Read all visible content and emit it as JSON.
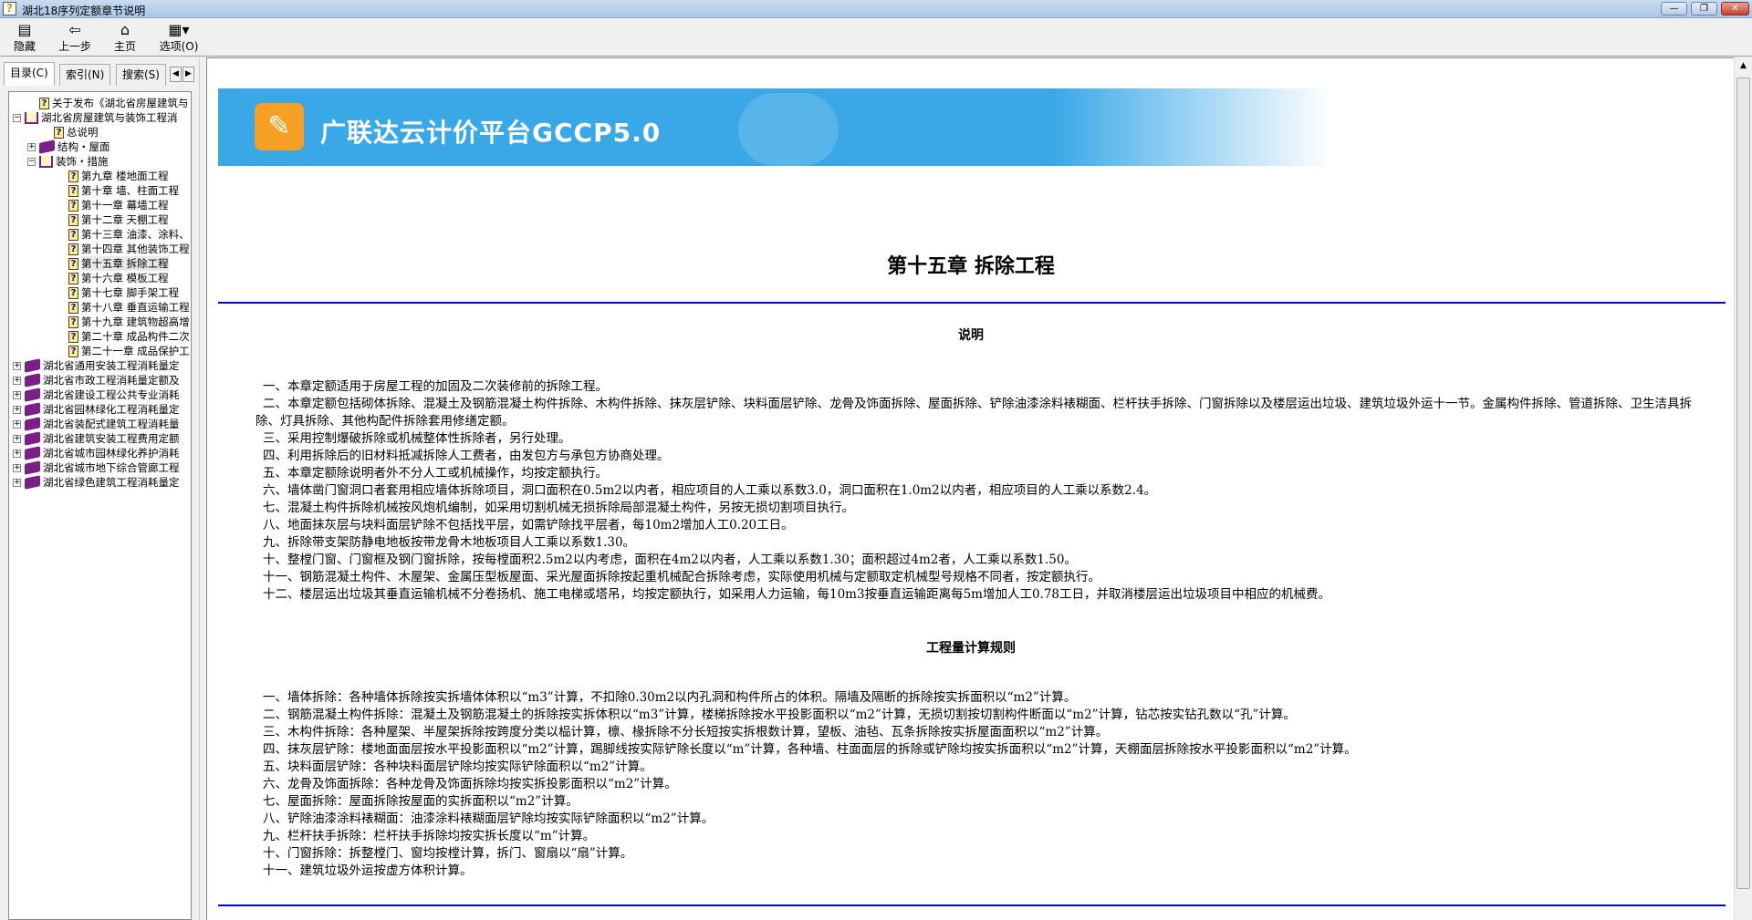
{
  "window": {
    "title": "湖北18序列定额章节说明",
    "min": "—",
    "restore": "❐",
    "close": "✕"
  },
  "toolbar": [
    {
      "label": "隐藏",
      "icon": "hide-icon"
    },
    {
      "label": "上一步",
      "icon": "back-icon"
    },
    {
      "label": "主页",
      "icon": "home-icon"
    },
    {
      "label": "选项(O)",
      "icon": "options-icon"
    }
  ],
  "tabs": [
    {
      "label": "目录(C)"
    },
    {
      "label": "索引(N)"
    },
    {
      "label": "搜索(S)"
    }
  ],
  "tree": [
    {
      "label": "关于发布《湖北省房屋建筑与",
      "type": "page",
      "level": 1
    },
    {
      "label": "湖北省房屋建筑与装饰工程消",
      "type": "open",
      "level": 0,
      "exp": "−"
    },
    {
      "label": "总说明",
      "type": "page",
      "level": 2
    },
    {
      "label": "结构・屋面",
      "type": "book",
      "level": 1,
      "exp": "+"
    },
    {
      "label": "装饰・措施",
      "type": "open",
      "level": 1,
      "exp": "−"
    },
    {
      "label": "第九章  楼地面工程",
      "type": "page",
      "level": 3
    },
    {
      "label": "第十章  墙、柱面工程",
      "type": "page",
      "level": 3
    },
    {
      "label": "第十一章  幕墙工程",
      "type": "page",
      "level": 3
    },
    {
      "label": "第十二章  天棚工程",
      "type": "page",
      "level": 3
    },
    {
      "label": "第十三章  油漆、涂料、",
      "type": "page",
      "level": 3
    },
    {
      "label": "第十四章  其他装饰工程",
      "type": "page",
      "level": 3
    },
    {
      "label": "第十五章  拆除工程",
      "type": "page",
      "level": 3,
      "selected": true
    },
    {
      "label": "第十六章  模板工程",
      "type": "page",
      "level": 3
    },
    {
      "label": "第十七章  脚手架工程",
      "type": "page",
      "level": 3
    },
    {
      "label": "第十八章  垂直运输工程",
      "type": "page",
      "level": 3
    },
    {
      "label": "第十九章  建筑物超高增",
      "type": "page",
      "level": 3
    },
    {
      "label": "第二十章  成品构件二次",
      "type": "page",
      "level": 3
    },
    {
      "label": "第二十一章  成品保护工",
      "type": "page",
      "level": 3
    },
    {
      "label": "湖北省通用安装工程消耗量定",
      "type": "book",
      "level": 0,
      "exp": "+"
    },
    {
      "label": "湖北省市政工程消耗量定额及",
      "type": "book",
      "level": 0,
      "exp": "+"
    },
    {
      "label": "湖北省建设工程公共专业消耗",
      "type": "book",
      "level": 0,
      "exp": "+"
    },
    {
      "label": "湖北省园林绿化工程消耗量定",
      "type": "book",
      "level": 0,
      "exp": "+"
    },
    {
      "label": "湖北省装配式建筑工程消耗量",
      "type": "book",
      "level": 0,
      "exp": "+"
    },
    {
      "label": "湖北省建筑安装工程费用定额",
      "type": "book",
      "level": 0,
      "exp": "+"
    },
    {
      "label": "湖北省城市园林绿化养护消耗",
      "type": "book",
      "level": 0,
      "exp": "+"
    },
    {
      "label": "湖北省城市地下综合管廊工程",
      "type": "book",
      "level": 0,
      "exp": "+"
    },
    {
      "label": "湖北省绿色建筑工程消耗量定",
      "type": "book",
      "level": 0,
      "exp": "+"
    }
  ],
  "banner": {
    "text": "广联达云计价平台GCCP5.0"
  },
  "doc": {
    "title": "第十五章  拆除工程",
    "section1": "说明",
    "notes": [
      "一、本章定额适用于房屋工程的加固及二次装修前的拆除工程。",
      "二、本章定额包括砌体拆除、混凝土及钢筋混凝土构件拆除、木构件拆除、抹灰层铲除、块料面层铲除、龙骨及饰面拆除、屋面拆除、铲除油漆涂料裱糊面、栏杆扶手拆除、门窗拆除以及楼层运出垃圾、建筑垃圾外运十一节。金属构件拆除、管道拆除、卫生洁具拆除、灯具拆除、其他构配件拆除套用修缮定额。",
      "三、采用控制爆破拆除或机械整体性拆除者，另行处理。",
      "四、利用拆除后的旧材料抵减拆除人工费者，由发包方与承包方协商处理。",
      "五、本章定额除说明者外不分人工或机械操作，均按定额执行。",
      "六、墙体凿门窗洞口者套用相应墙体拆除项目，洞口面积在0.5m2以内者，相应项目的人工乘以系数3.0，洞口面积在1.0m2以内者，相应项目的人工乘以系数2.4。",
      "七、混凝土构件拆除机械按风炮机编制，如采用切割机械无损拆除局部混凝土构件，另按无损切割项目执行。",
      "八、地面抹灰层与块料面层铲除不包括找平层，如需铲除找平层者，每10m2增加人工0.20工日。",
      "九、拆除带支架防静电地板按带龙骨木地板项目人工乘以系数1.30。",
      "十、整樘门窗、门窗框及钢门窗拆除，按每樘面积2.5m2以内考虑，面积在4m2以内者，人工乘以系数1.30；面积超过4m2者，人工乘以系数1.50。",
      "十一、钢筋混凝土构件、木屋架、金属压型板屋面、采光屋面拆除按起重机械配合拆除考虑，实际使用机械与定额取定机械型号规格不同者，按定额执行。",
      "十二、楼层运出垃圾其垂直运输机械不分卷扬机、施工电梯或塔吊，均按定额执行，如采用人力运输，每10m3按垂直运输距离每5m增加人工0.78工日，并取消楼层运出垃圾项目中相应的机械费。"
    ],
    "section2": "工程量计算规则",
    "rules": [
      "一、墙体拆除：各种墙体拆除按实拆墙体体积以“m3”计算，不扣除0.30m2以内孔洞和构件所占的体积。隔墙及隔断的拆除按实拆面积以“m2”计算。",
      "二、钢筋混凝土构件拆除：混凝土及钢筋混凝土的拆除按实拆体积以“m3”计算，楼梯拆除按水平投影面积以“m2”计算，无损切割按切割构件断面以“m2”计算，钻芯按实钻孔数以“孔”计算。",
      "三、木构件拆除：各种屋架、半屋架拆除按跨度分类以榀计算，檩、椽拆除不分长短按实拆根数计算，望板、油毡、瓦条拆除按实拆屋面面积以“m2”计算。",
      "四、抹灰层铲除：楼地面面层按水平投影面积以“m2”计算，踢脚线按实际铲除长度以“m”计算，各种墙、柱面面层的拆除或铲除均按实拆面积以“m2”计算，天棚面层拆除按水平投影面积以“m2”计算。",
      "五、块料面层铲除：各种块料面层铲除均按实际铲除面积以“m2”计算。",
      "六、龙骨及饰面拆除：各种龙骨及饰面拆除均按实拆投影面积以“m2”计算。",
      "七、屋面拆除：屋面拆除按屋面的实拆面积以“m2”计算。",
      "八、铲除油漆涂料裱糊面：油漆涂料裱糊面层铲除均按实际铲除面积以“m2”计算。",
      "九、栏杆扶手拆除：栏杆扶手拆除均按实拆长度以“m”计算。",
      "十、门窗拆除：拆整樘门、窗均按樘计算，拆门、窗扇以“扇”计算。",
      "十一、建筑垃圾外运按虚方体积计算。"
    ]
  }
}
